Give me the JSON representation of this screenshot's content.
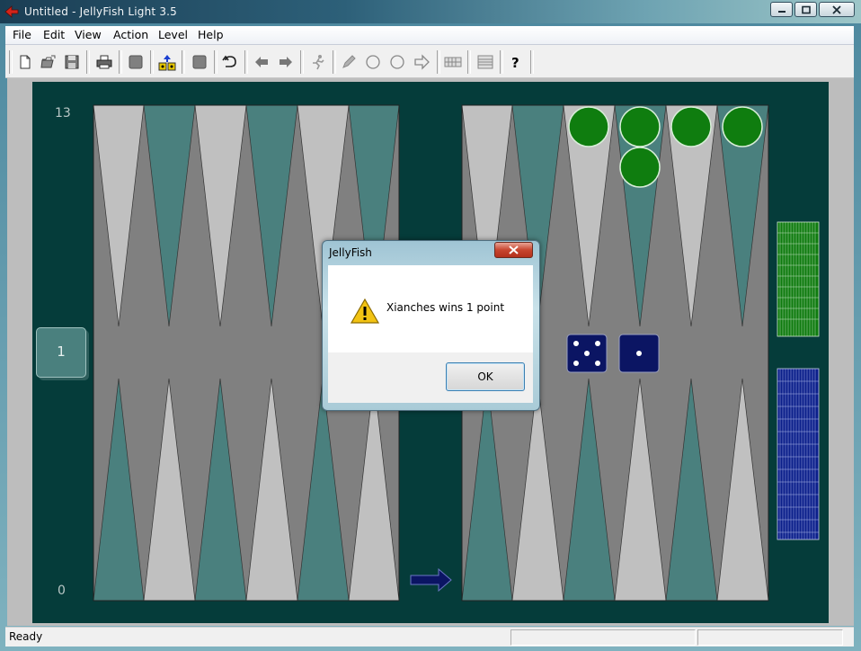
{
  "window": {
    "title": "Untitled - JellyFish Light 3.5",
    "controls": [
      "minimize",
      "maximize",
      "close"
    ]
  },
  "menubar": {
    "items": [
      "File",
      "Edit",
      "View",
      "Action",
      "Level",
      "Help"
    ]
  },
  "toolbar": {
    "icons": [
      "new-file-icon",
      "open-folder-icon",
      "save-icon",
      "print-icon",
      "square-icon",
      "swap-dice-icon",
      "square-icon",
      "undo-icon",
      "arrow-left-icon",
      "arrow-right-icon",
      "runner-icon",
      "pencil-icon",
      "circle-icon",
      "circle-icon",
      "outline-arrow-right-icon",
      "grid-icon",
      "grid-icon",
      "help-icon"
    ]
  },
  "board": {
    "point_labels": {
      "top_left": "13",
      "bottom_left": "0"
    },
    "cube_value": "1",
    "dice": [
      5,
      1
    ],
    "colors": {
      "board_bg": "#053c3a",
      "board_field": "#808080",
      "triangle_light": "#c0c0c0",
      "triangle_teal": "#4a807e",
      "checker_green": "#0f7d0f",
      "dice_navy": "#0b1563",
      "tray_green": "#0e7a0e",
      "tray_blue": "#0b1f8a"
    }
  },
  "dialog": {
    "title": "JellyFish",
    "message": "Xianches wins 1 point",
    "ok_label": "OK",
    "icon": "warning-icon"
  },
  "statusbar": {
    "text": "Ready"
  }
}
